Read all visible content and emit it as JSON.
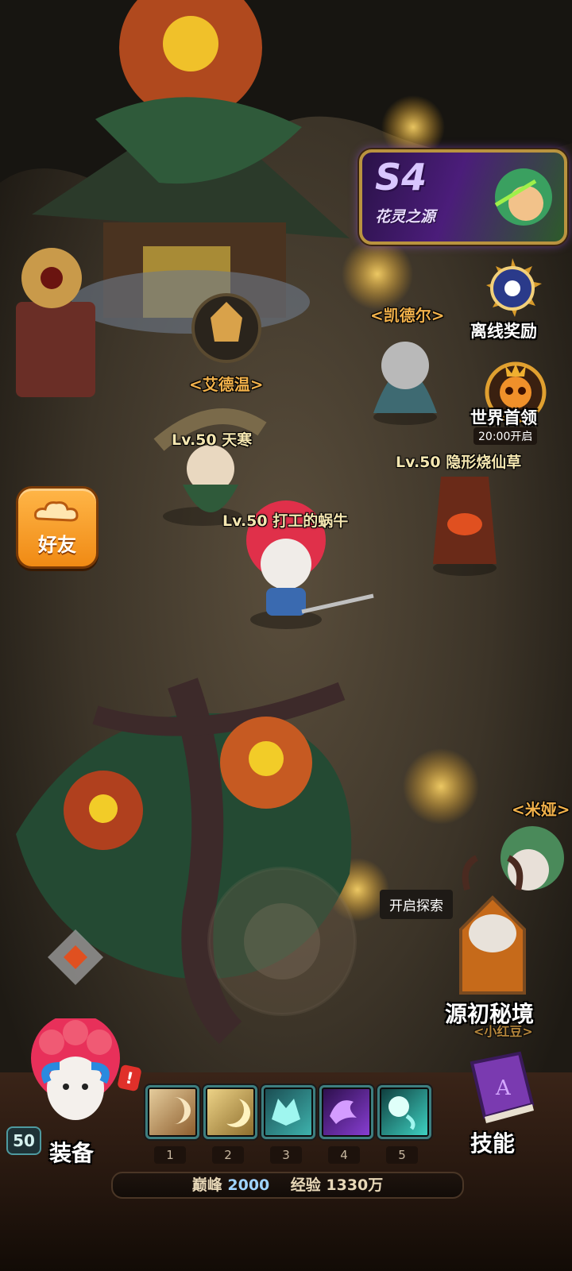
{
  "season_banner": {
    "season": "S4",
    "title": "花灵之源"
  },
  "npcs": [
    {
      "key": "edwin",
      "name": "<艾德温>"
    },
    {
      "key": "kaider",
      "name": "<凯德尔>"
    },
    {
      "key": "mia",
      "name": "<米娅>"
    },
    {
      "key": "little-red-bean",
      "name": "<小红豆>"
    }
  ],
  "players": [
    {
      "level": "Lv.50",
      "name": "天寒"
    },
    {
      "level": "Lv.50",
      "name": "打工的蜗牛"
    },
    {
      "level": "Lv.50",
      "name": "隐形烧仙草"
    }
  ],
  "right_menu": {
    "offline_reward": "离线奖励",
    "world_boss": "世界首领",
    "world_boss_time": "20:00开启"
  },
  "friends_button": "好友",
  "explore_tooltip": "开启探索",
  "dungeon_label": "源初秘境",
  "hero": {
    "level": "50",
    "equip_label": "装备",
    "alert_icon": "!"
  },
  "skill_slots": [
    {
      "num": "1",
      "icon": "earth-slash-icon",
      "color": "#c9a46a"
    },
    {
      "num": "2",
      "icon": "moon-crescent-icon",
      "color": "#d6b46a"
    },
    {
      "num": "3",
      "icon": "wolf-spirit-icon",
      "color": "#3fb6b0"
    },
    {
      "num": "4",
      "icon": "purple-dragon-icon",
      "color": "#8a3fd6"
    },
    {
      "num": "5",
      "icon": "cyan-orb-icon",
      "color": "#3fd6c6"
    }
  ],
  "skills_label": "技能",
  "stats": {
    "peak_label": "巅峰",
    "peak_value": "2000",
    "exp_label": "经验",
    "exp_value": "1330万"
  },
  "colors": {
    "npc_name": "#f0b04a",
    "player_name": "#f4e6b0",
    "accent_orange": "#f08a14"
  }
}
